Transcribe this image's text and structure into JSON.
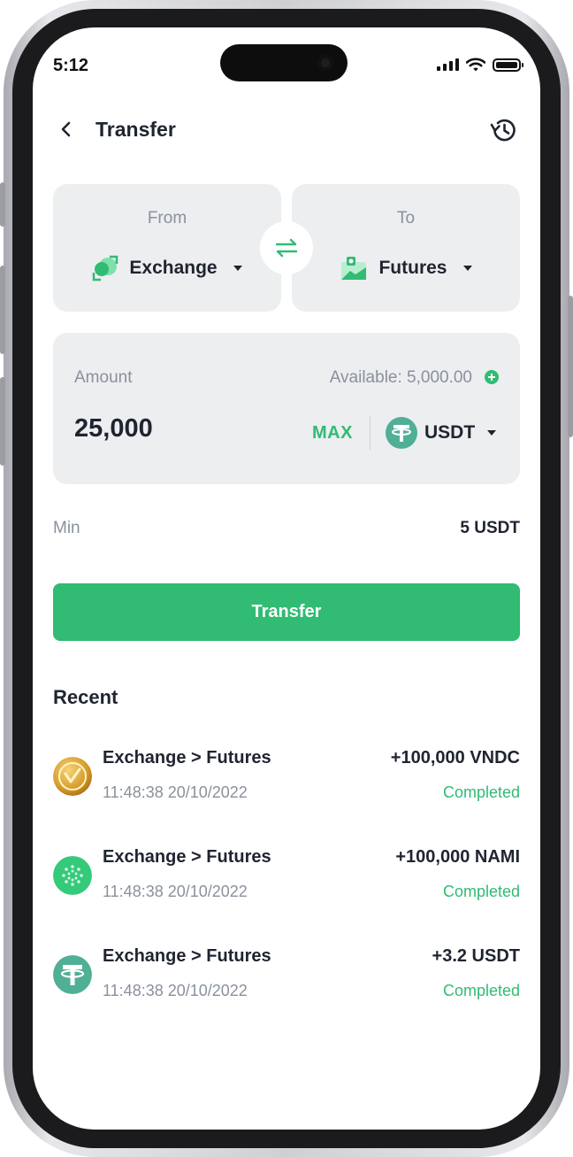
{
  "status_bar": {
    "time": "5:12"
  },
  "header": {
    "title": "Transfer"
  },
  "from": {
    "label": "From",
    "wallet": "Exchange",
    "icon": "exchange-wallet-icon"
  },
  "to": {
    "label": "To",
    "wallet": "Futures",
    "icon": "futures-wallet-icon"
  },
  "amount": {
    "label": "Amount",
    "available": "Available: 5,000.00",
    "value": "25,000",
    "max_label": "MAX",
    "coin": "USDT"
  },
  "min": {
    "label": "Min",
    "value": "5 USDT"
  },
  "transfer_button": "Transfer",
  "recent": {
    "title": "Recent",
    "items": [
      {
        "route": "Exchange > Futures",
        "time": "11:48:38 20/10/2022",
        "amount": "+100,000 VNDC",
        "status": "Completed",
        "icon": "vndc-coin-icon"
      },
      {
        "route": "Exchange > Futures",
        "time": "11:48:38 20/10/2022",
        "amount": "+100,000 NAMI",
        "status": "Completed",
        "icon": "nami-coin-icon"
      },
      {
        "route": "Exchange > Futures",
        "time": "11:48:38 20/10/2022",
        "amount": "+3.2 USDT",
        "status": "Completed",
        "icon": "usdt-coin-icon"
      }
    ]
  },
  "colors": {
    "accent": "#31bb73",
    "card_bg": "#eceef0",
    "muted_text": "#8a919c",
    "text": "#1f2430"
  }
}
